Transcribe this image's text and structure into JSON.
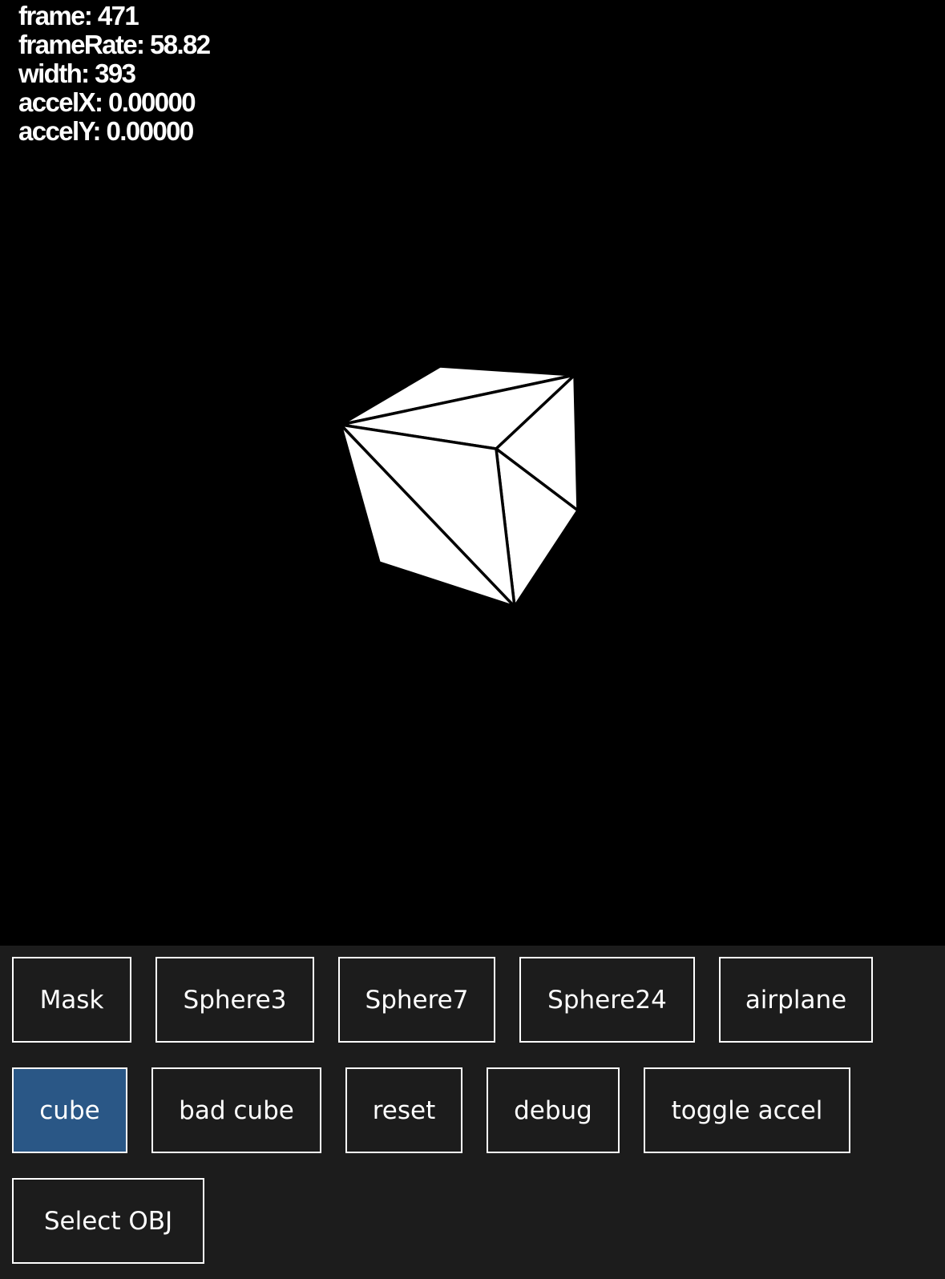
{
  "stats": {
    "frame": "frame: 471",
    "frame_rate": "frameRate: 58.82",
    "width": "width: 393",
    "accel_x": "accelX: 0.00000",
    "accel_y": "accelY: 0.00000"
  },
  "buttons": {
    "mask": "Mask",
    "sphere3": "Sphere3",
    "sphere7": "Sphere7",
    "sphere24": "Sphere24",
    "airplane": "airplane",
    "cube": "cube",
    "bad_cube": "bad cube",
    "reset": "reset",
    "debug": "debug",
    "toggle_accel": "toggle accel",
    "select_obj": "Select OBJ"
  },
  "active_button": "cube",
  "colors": {
    "canvas": "#000000",
    "panel": "#1c1c1c",
    "active_button": "#2a5786",
    "mesh_fill": "#ffffff",
    "mesh_edge": "#000000"
  }
}
